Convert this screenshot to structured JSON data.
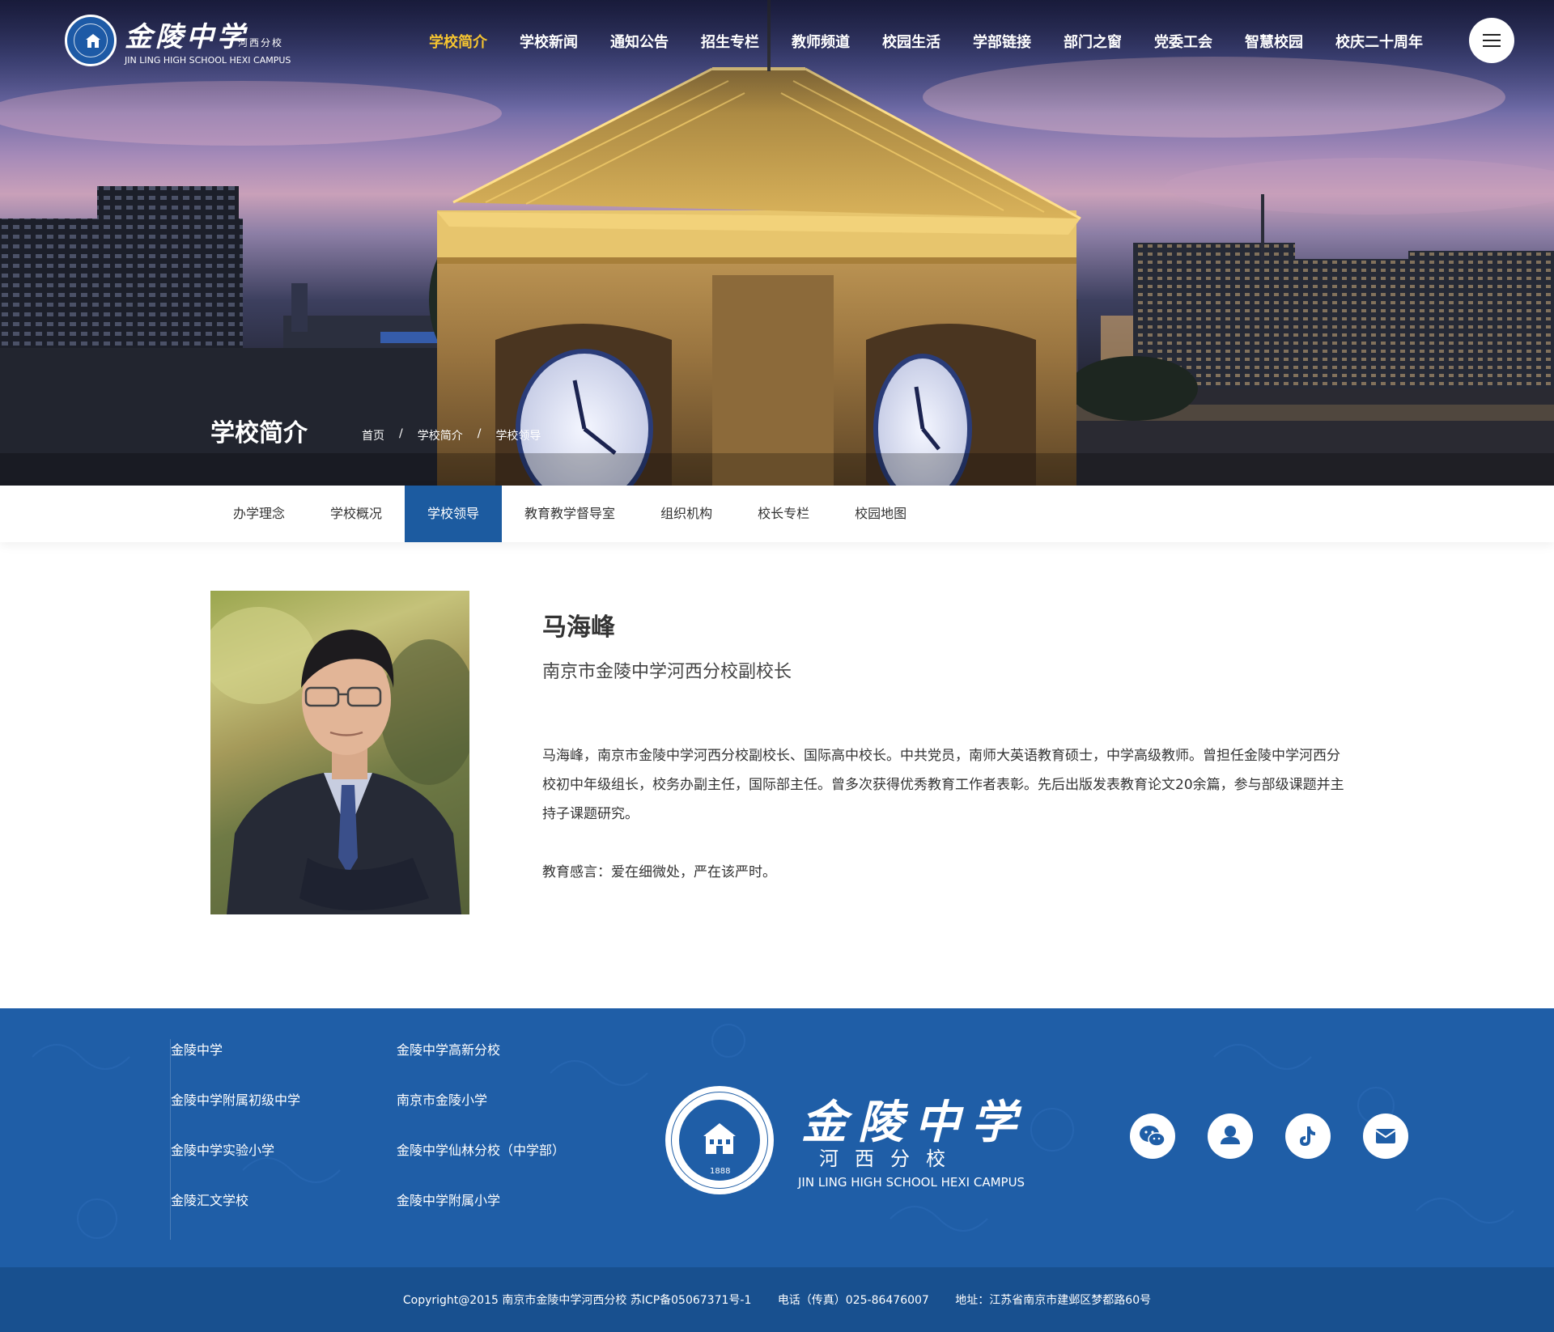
{
  "header": {
    "logo": {
      "name_cn": "金陵中学",
      "branch_cn": "河西分校",
      "name_en": "JIN LING HIGH SCHOOL HEXI CAMPUS"
    },
    "nav": [
      {
        "label": "学校简介",
        "active": true
      },
      {
        "label": "学校新闻"
      },
      {
        "label": "通知公告"
      },
      {
        "label": "招生专栏"
      },
      {
        "label": "教师频道"
      },
      {
        "label": "校园生活"
      },
      {
        "label": "学部链接"
      },
      {
        "label": "部门之窗"
      },
      {
        "label": "党委工会"
      },
      {
        "label": "智慧校园"
      },
      {
        "label": "校庆二十周年"
      }
    ],
    "menu_icon": "hamburger-menu-icon"
  },
  "banner": {
    "title": "学校简介",
    "breadcrumb": [
      "首页",
      "学校简介",
      "学校领导"
    ],
    "breadcrumb_separator": "/"
  },
  "subnav": [
    {
      "label": "办学理念"
    },
    {
      "label": "学校概况"
    },
    {
      "label": "学校领导",
      "active": true
    },
    {
      "label": "教育教学督导室"
    },
    {
      "label": "组织机构"
    },
    {
      "label": "校长专栏"
    },
    {
      "label": "校园地图"
    }
  ],
  "profile": {
    "name": "马海峰",
    "position": "南京市金陵中学河西分校副校长",
    "bio": "马海峰，南京市金陵中学河西分校副校长、国际高中校长。中共党员，南师大英语教育硕士，中学高级教师。曾担任金陵中学河西分校初中年级组长，校务办副主任，国际部主任。曾多次获得优秀教育工作者表彰。先后出版发表教育论文20余篇，参与部级课题并主持子课题研究。",
    "motto": "教育感言：爱在细微处，严在该严时。"
  },
  "footer": {
    "links_col1": [
      "金陵中学",
      "金陵中学附属初级中学",
      "金陵中学实验小学",
      "金陵汇文学校"
    ],
    "links_col2": [
      "金陵中学高新分校",
      "南京市金陵小学",
      "金陵中学仙林分校（中学部）",
      "金陵中学附属小学"
    ],
    "logo": {
      "name_cn": "金陵中学",
      "branch_cn": "河西分校",
      "name_en": "JIN LING HIGH SCHOOL HEXI CAMPUS",
      "seal_year": "1888"
    },
    "social_icons": [
      "wechat-icon",
      "user-icon",
      "tiktok-icon",
      "mail-icon"
    ],
    "copyright": "Copyright@2015 南京市金陵中学河西分校  苏ICP备05067371号-1",
    "phone": "电话（传真）025-86476007",
    "address": "地址：江苏省南京市建邺区梦都路60号"
  },
  "colors": {
    "primary_blue": "#1c5ba0",
    "footer_blue": "#1f5ea7",
    "bottom_bar": "#18508f",
    "nav_active": "#f5c430"
  }
}
